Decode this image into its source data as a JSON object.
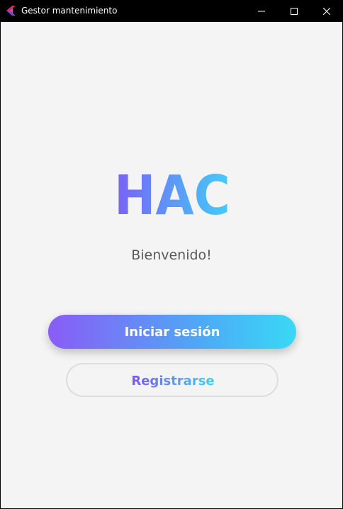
{
  "window": {
    "title": "Gestor mantenimiento",
    "controls": [
      "minimize-icon",
      "maximize-icon",
      "close-icon"
    ]
  },
  "main": {
    "logo_text": "HAC",
    "welcome_text": "Bienvenido!",
    "login_button_label": "Iniciar sesión",
    "register_button_label": "Registrarse"
  },
  "colors": {
    "titlebar_bg": "#000000",
    "content_bg": "#f4f4f4",
    "gradient_start": "#8a5cf6",
    "gradient_mid": "#4fa7f6",
    "gradient_end": "#38d9f5",
    "welcome_text": "#595959",
    "register_border": "#dedede"
  }
}
